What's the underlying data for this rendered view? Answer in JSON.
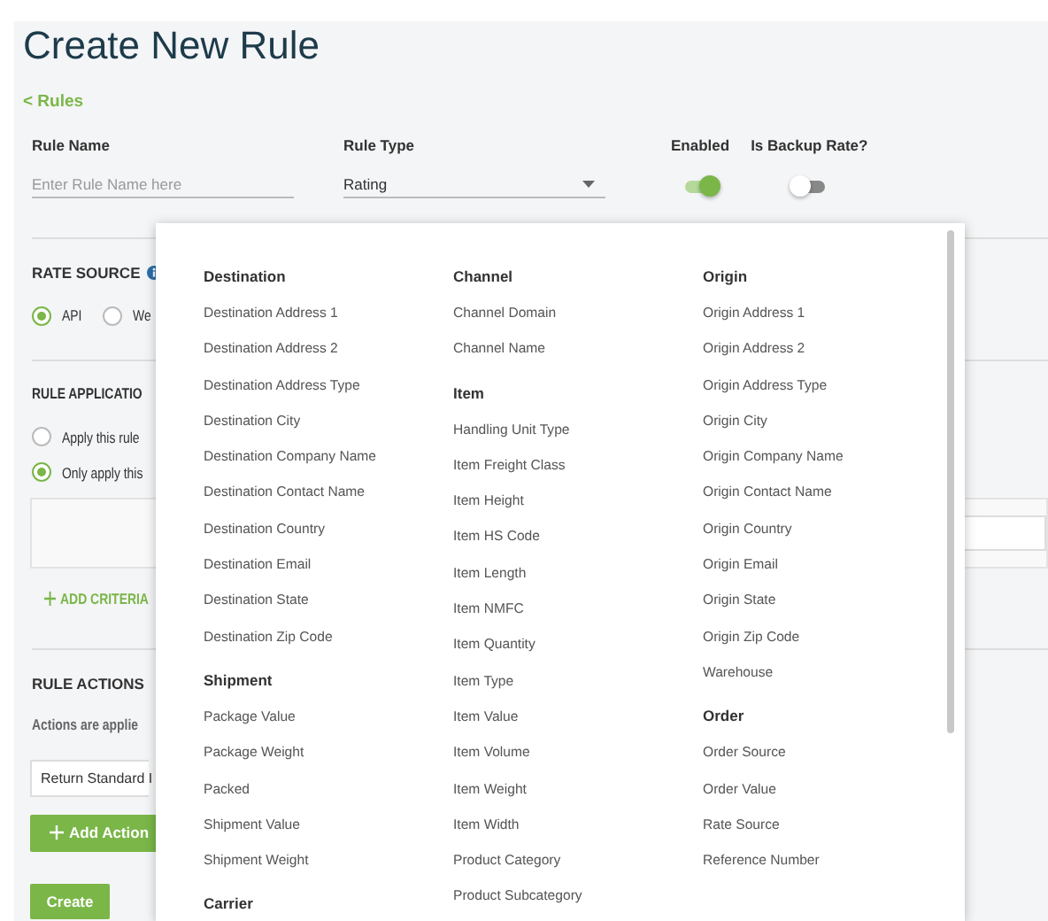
{
  "title": "Create New Rule",
  "back_link": "< Rules",
  "fields": [
    {
      "label": "Rule Name",
      "placeholder": "Enter Rule Name here"
    },
    {
      "label": "Rule Type",
      "value": "Rating"
    }
  ],
  "toggles": [
    {
      "label": "Enabled",
      "on": true
    },
    {
      "label": "Is Backup Rate?",
      "on": false
    }
  ],
  "rate_source": {
    "heading": "RATE SOURCE",
    "options": [
      {
        "label": "API",
        "selected": true
      },
      {
        "label": "We",
        "selected": false
      }
    ]
  },
  "rule_application": {
    "heading": "RULE APPLICATIO",
    "options": [
      {
        "label": "Apply this rule",
        "selected": false
      },
      {
        "label": "Only apply this",
        "selected": true
      }
    ],
    "add_criteria": "ADD CRITERIA"
  },
  "rule_actions": {
    "heading": "RULE ACTIONS",
    "note": "Actions are applie",
    "action_select": "Return Standard I",
    "add_action": "Add Action"
  },
  "create_button": "Create",
  "menu": {
    "columns": [
      {
        "groups": [
          {
            "heading": "Destination",
            "items": [
              "Destination Address 1",
              "Destination Address 2",
              "Destination Address Type",
              "Destination City",
              "Destination Company Name",
              "Destination Contact Name",
              "Destination Country",
              "Destination Email",
              "Destination State",
              "Destination Zip Code"
            ]
          },
          {
            "heading": "Shipment",
            "items": [
              "Package Value",
              "Package Weight",
              "Packed",
              "Shipment Value",
              "Shipment Weight"
            ]
          },
          {
            "heading": "Carrier"
          }
        ]
      },
      {
        "groups": [
          {
            "heading": "Channel",
            "items": [
              "Channel Domain",
              "Channel Name"
            ]
          },
          {
            "heading": "Item",
            "items": [
              "Handling Unit Type",
              "Item Freight Class",
              "Item Height",
              "Item HS Code",
              "Item Length",
              "Item NMFC",
              "Item Quantity",
              "Item Type",
              "Item Value",
              "Item Volume",
              "Item Weight",
              "Item Width",
              "Product Category",
              "Product Subcategory"
            ]
          }
        ]
      },
      {
        "groups": [
          {
            "heading": "Origin",
            "items": [
              "Origin Address 1",
              "Origin Address 2",
              "Origin Address Type",
              "Origin City",
              "Origin Company Name",
              "Origin Contact Name",
              "Origin Country",
              "Origin Email",
              "Origin State",
              "Origin Zip Code",
              "Warehouse"
            ]
          },
          {
            "heading": "Order",
            "items": [
              "Order Source",
              "Order Value",
              "Rate Source",
              "Reference Number"
            ]
          }
        ]
      }
    ]
  }
}
